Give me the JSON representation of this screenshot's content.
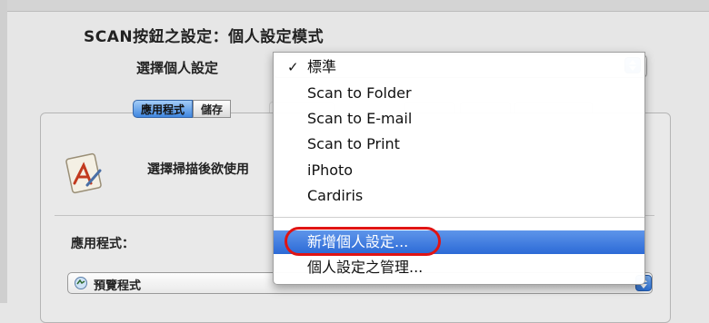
{
  "dialog": {
    "title": "SCAN按鈕之設定：個人設定模式",
    "profile_label": "選擇個人設定",
    "selected_profile": "標準"
  },
  "tabs": [
    {
      "label": "應用程式",
      "active": true
    },
    {
      "label": "儲存",
      "active": false
    }
  ],
  "panel": {
    "description": "選擇掃描後欲使用",
    "application_label": "應用程式：",
    "application_value": "預覽程式"
  },
  "menu": {
    "items": [
      {
        "label": "標準",
        "checked": true
      },
      {
        "label": "Scan to Folder"
      },
      {
        "label": "Scan to E-mail"
      },
      {
        "label": "Scan to Print"
      },
      {
        "label": "iPhoto"
      },
      {
        "label": "Cardiris"
      }
    ],
    "actions": [
      {
        "label": "新增個人設定...",
        "highlighted": true
      },
      {
        "label": "個人設定之管理..."
      }
    ],
    "check_glyph": "✓"
  },
  "colors": {
    "highlight": "#2c6ad6",
    "annotation_ring": "#e01414",
    "arrow_button": "#2b6fd3"
  },
  "icons": {
    "popup_arrows": "up-down-arrows-icon",
    "application": "scan-app-icon",
    "preview_app": "preview-app-icon"
  }
}
